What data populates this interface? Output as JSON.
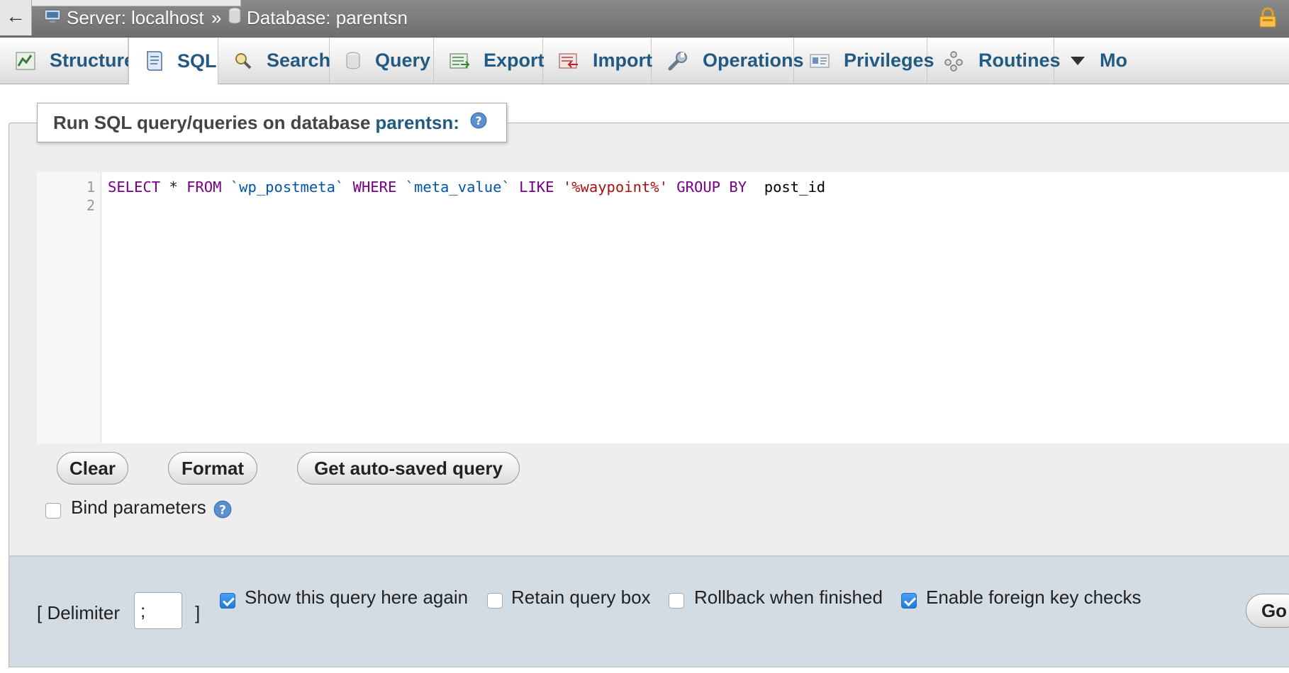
{
  "breadcrumb": {
    "back_label": "←",
    "server": "Server: localhost",
    "separator": "»",
    "database": "Database: parentsn"
  },
  "tabs": [
    {
      "label": "Structure",
      "icon": "structure-icon"
    },
    {
      "label": "SQL",
      "icon": "sql-icon",
      "active": true
    },
    {
      "label": "Search",
      "icon": "search-icon"
    },
    {
      "label": "Query",
      "icon": "query-icon"
    },
    {
      "label": "Export",
      "icon": "export-icon"
    },
    {
      "label": "Import",
      "icon": "import-icon"
    },
    {
      "label": "Operations",
      "icon": "wrench-icon"
    },
    {
      "label": "Privileges",
      "icon": "privileges-icon"
    },
    {
      "label": "Routines",
      "icon": "routines-icon"
    },
    {
      "label": "Mo",
      "icon": "chevron-down-icon"
    }
  ],
  "panel": {
    "title_prefix": "Run SQL query/queries on database",
    "db_name": "parentsn:"
  },
  "editor": {
    "line_numbers": [
      "1",
      "2"
    ],
    "tokens": {
      "t1": "SELECT",
      "t2": " * ",
      "t3": "FROM",
      "t4": " ",
      "t5": "`wp_postmeta`",
      "t6": " ",
      "t7": "WHERE",
      "t8": " ",
      "t9": "`meta_value`",
      "t10": " ",
      "t11": "LIKE",
      "t12": " ",
      "t13": "'%waypoint%'",
      "t14": " ",
      "t15": "GROUP BY",
      "t16": "  ",
      "t17": "post_id"
    }
  },
  "buttons": {
    "clear": "Clear",
    "format": "Format",
    "autosaved": "Get auto-saved query",
    "go": "Go"
  },
  "options": {
    "bind_parameters": {
      "label": "Bind parameters",
      "checked": false
    },
    "delimiter_prefix": "[ Delimiter",
    "delimiter_value": ";",
    "delimiter_suffix": "]",
    "show_query": {
      "label": "Show this query here again",
      "checked": true
    },
    "retain_box": {
      "label": "Retain query box",
      "checked": false
    },
    "rollback": {
      "label": "Rollback when finished",
      "checked": false
    },
    "foreign_keys": {
      "label": "Enable foreign key checks",
      "checked": true
    }
  },
  "colors": {
    "link_blue": "#235a81",
    "keyword": "#770088",
    "string": "#aa1111",
    "identifier": "#0055aa",
    "checkbox_checked": "#1f7bd8"
  }
}
